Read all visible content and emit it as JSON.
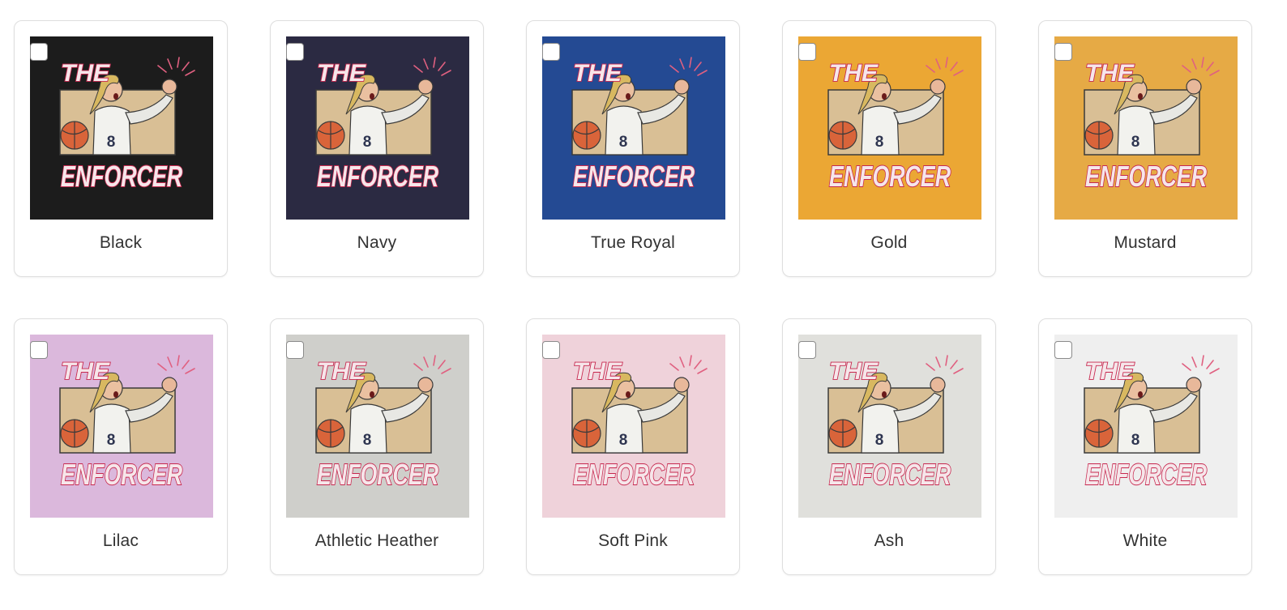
{
  "design": {
    "line1": "THE",
    "line2": "ENFORCER",
    "jersey_number": "8"
  },
  "swatches": [
    {
      "name": "Black",
      "color": "#1c1c1c",
      "checked": false
    },
    {
      "name": "Navy",
      "color": "#2b2a42",
      "checked": false
    },
    {
      "name": "True Royal",
      "color": "#244a93",
      "checked": false
    },
    {
      "name": "Gold",
      "color": "#eba734",
      "checked": false
    },
    {
      "name": "Mustard",
      "color": "#e6aa45",
      "checked": false
    },
    {
      "name": "Lilac",
      "color": "#dbb8dc",
      "checked": false
    },
    {
      "name": "Athletic Heather",
      "color": "#cfcfcb",
      "checked": false
    },
    {
      "name": "Soft Pink",
      "color": "#efd2da",
      "checked": false
    },
    {
      "name": "Ash",
      "color": "#e0e0dc",
      "checked": false
    },
    {
      "name": "White",
      "color": "#efefef",
      "checked": false
    }
  ]
}
